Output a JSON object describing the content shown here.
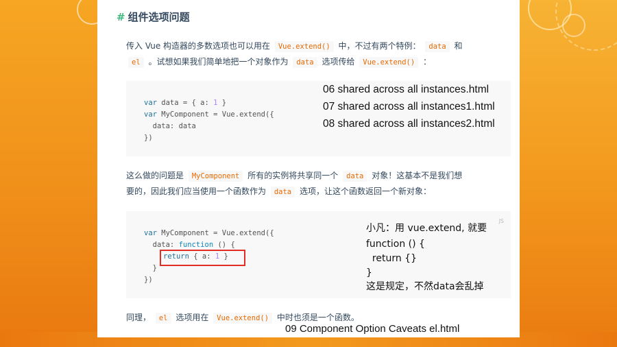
{
  "heading": "组件选项问题",
  "para1": {
    "line1_a": "传入 Vue 构造器的多数选项也可以用在",
    "code_extend": "Vue.extend()",
    "line1_b": "中，不过有两个特例：",
    "code_data": "data",
    "line1_c": "和",
    "code_el": "el",
    "line2_a": "。试想如果我们简单地把一个对象作为",
    "code_data2": "data",
    "line2_b": "选项传给",
    "code_extend2": "Vue.extend()",
    "line2_c": "："
  },
  "code1": {
    "lines": [
      {
        "kw": "var",
        "rest": " data = { a: ",
        "num": "1",
        "end": " }"
      },
      {
        "kw": "var",
        "rest": " MyComponent = Vue.extend({",
        "num": "",
        "end": ""
      },
      {
        "kw": "",
        "rest": "  data: data",
        "num": "",
        "end": ""
      },
      {
        "kw": "",
        "rest": "})",
        "num": "",
        "end": ""
      }
    ]
  },
  "files_overlay": [
    "06 shared across all instances.html",
    "07 shared across all instances1.html",
    "08 shared across all instances2.html"
  ],
  "para2": {
    "line1_a": "这么做的问题是",
    "code_mycomp": "MyComponent",
    "line1_b": "所有的实例将共享同一个",
    "code_data": "data",
    "line1_c": "对象！这基本不是我们想",
    "line2_a": "要的，因此我们应当使用一个函数作为",
    "code_data2": "data",
    "line2_b": "选项，让这个函数返回一个新对象："
  },
  "code2": {
    "lang": "JS",
    "l1_kw": "var",
    "l1_rest": " MyComponent = Vue.extend({",
    "l2_a": "  data: ",
    "l2_fn": "function",
    "l2_b": " () {",
    "l3_kw": "return",
    "l3_a": " { a: ",
    "l3_num": "1",
    "l3_b": " }",
    "l4": "  }",
    "l5": "})"
  },
  "note": {
    "line1": "小凡：用 vue.extend, 就要",
    "line2": "function () {",
    "line3": "  return {}",
    "line4": "}",
    "line5": "这是规定，不然data会乱掉"
  },
  "para3": {
    "a": "同理，",
    "code_el": "el",
    "b": "选项用在",
    "code_extend": "Vue.extend()",
    "c": "中时也须是一个函数。"
  },
  "footer_file": "09 Component Option Caveats el.html",
  "colors": {
    "accent_green": "#42b983",
    "inline_code": "#e96900",
    "highlight_box": "#e02e24",
    "frame_orange": "#f39a1e"
  }
}
